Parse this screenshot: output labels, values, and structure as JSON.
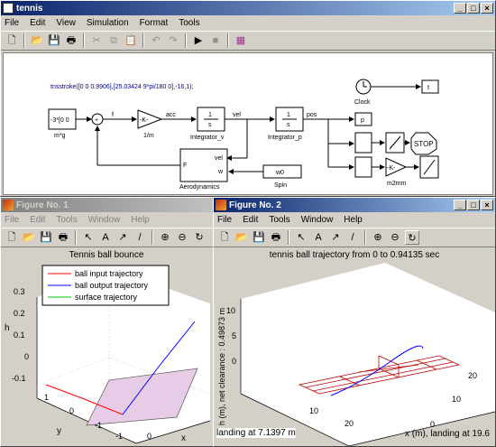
{
  "sim": {
    "title": "tennis",
    "menu": [
      "File",
      "Edit",
      "View",
      "Simulation",
      "Format",
      "Tools"
    ],
    "diagram": {
      "command": "tnsstroke([0 0 0.9906],[25.03424 9*pi/180 0],-16,1);",
      "gain_block": "-3*[0 0",
      "gain_block_label": "m*g",
      "sum_sign": "+",
      "f_label": "f",
      "k_gain": "-K-",
      "k_gain_label": "1/m",
      "acc_label": "acc",
      "integ_v_top": "1",
      "integ_v_bottom": "s",
      "integ_v_label": "Integrator_v",
      "vel_label": "vel",
      "integ_p_top": "1",
      "integ_p_bottom": "s",
      "integ_p_label": "Integrator_p",
      "pos_label": "pos",
      "p_block": "p",
      "clock_label": "Clock",
      "t_block": "t",
      "stop_block": "STOP",
      "aero_F": "F",
      "aero_vel": "vel",
      "aero_w": "w",
      "aero_label": "Aerodynamics",
      "w0_block": "w0",
      "spin_label": "Spin",
      "k2_gain": "-K-",
      "m2mm_label": "m2mm"
    }
  },
  "fig1": {
    "title": "Figure No. 1",
    "menu": [
      "File",
      "Edit",
      "Tools",
      "Window",
      "Help"
    ],
    "plot_title": "Tennis ball bounce",
    "ylabel": "h",
    "xlabel": "x",
    "xlabel2": "y",
    "legend": [
      {
        "label": "ball input trajectory",
        "color": "#ff0000"
      },
      {
        "label": "ball output trajectory",
        "color": "#0000ff"
      },
      {
        "label": "surface trajectory",
        "color": "#00c000"
      }
    ],
    "z_ticks": [
      "0.3",
      "0.2",
      "0.1",
      "0",
      "-0.1"
    ],
    "y_ticks": [
      "1",
      "0",
      "-1"
    ],
    "x_ticks": [
      "-1",
      "0"
    ]
  },
  "fig2": {
    "title": "Figure No. 2",
    "menu": [
      "File",
      "Edit",
      "Tools",
      "Window",
      "Help"
    ],
    "plot_title": "tennis ball trajectory from 0 to 0.94135 sec",
    "ylabel": "h (m), net clearance : 0.49873 m",
    "xlabel": "x (m), landing at 19.6",
    "ylabel2": "landing at 7.1397 m",
    "z_ticks": [
      "10",
      "5",
      "0"
    ],
    "x_ticks": [
      "10",
      "20"
    ],
    "y_ticks": [
      "0",
      "10",
      "20"
    ]
  },
  "colors": {
    "court": "#c00000",
    "trajectory": "#0000ff",
    "surface": "#e6cce6"
  }
}
